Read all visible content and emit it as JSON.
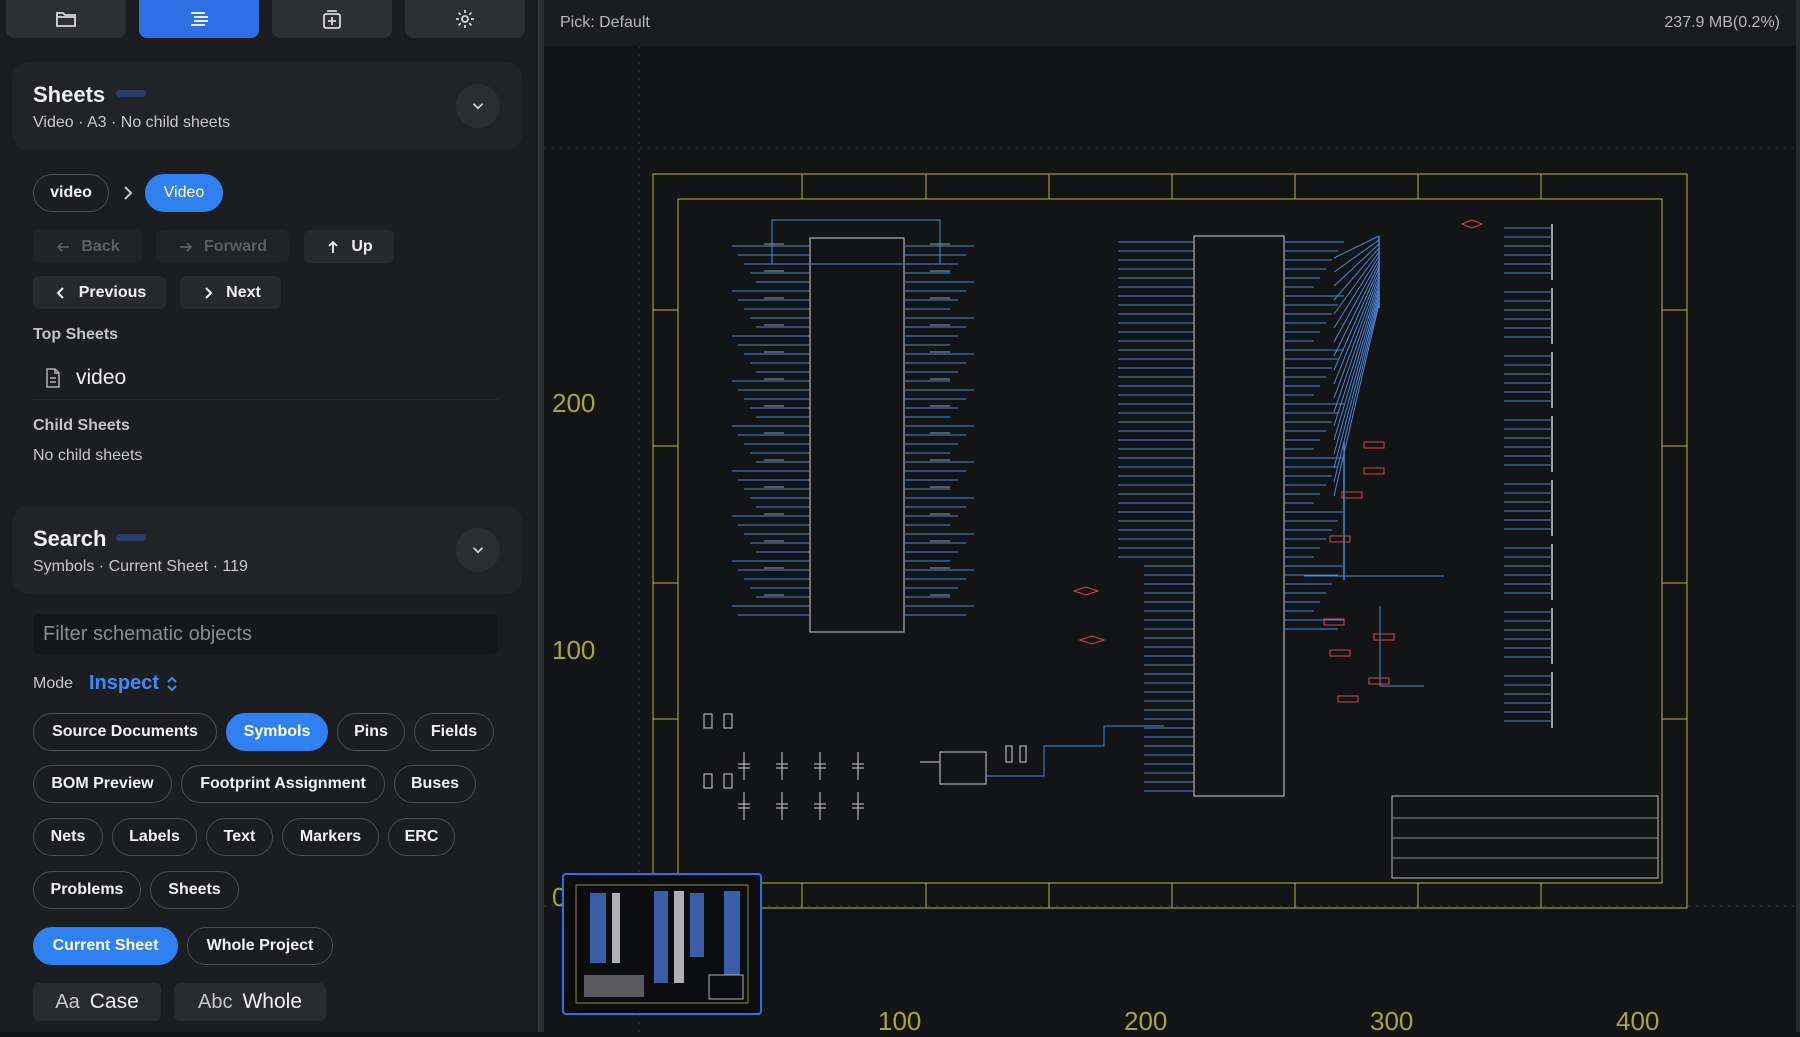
{
  "toolbar": {
    "tabs": [
      {
        "icon": "folder-icon"
      },
      {
        "icon": "list-icon",
        "active": true
      },
      {
        "icon": "add-sheet-icon"
      },
      {
        "icon": "gear-icon"
      }
    ]
  },
  "sheets": {
    "title": "Sheets",
    "subtitle": "Video · A3 · No child sheets",
    "breadcrumb": [
      "video",
      "Video"
    ],
    "back_label": "Back",
    "forward_label": "Forward",
    "up_label": "Up",
    "previous_label": "Previous",
    "next_label": "Next",
    "top_sheets_label": "Top Sheets",
    "top_sheet_item": "video",
    "child_sheets_label": "Child Sheets",
    "child_sheets_empty": "No child sheets"
  },
  "search": {
    "title": "Search",
    "subtitle": "Symbols · Current Sheet · 119",
    "placeholder": "Filter schematic objects",
    "mode_label": "Mode",
    "mode_value": "Inspect",
    "categories": [
      {
        "label": "Source Documents",
        "selected": false
      },
      {
        "label": "Symbols",
        "selected": true
      },
      {
        "label": "Pins",
        "selected": false
      },
      {
        "label": "Fields",
        "selected": false
      },
      {
        "label": "BOM Preview",
        "selected": false
      },
      {
        "label": "Footprint Assignment",
        "selected": false
      },
      {
        "label": "Buses",
        "selected": false
      },
      {
        "label": "Nets",
        "selected": false
      },
      {
        "label": "Labels",
        "selected": false
      },
      {
        "label": "Text",
        "selected": false
      },
      {
        "label": "Markers",
        "selected": false
      },
      {
        "label": "ERC",
        "selected": false
      },
      {
        "label": "Problems",
        "selected": false
      },
      {
        "label": "Sheets",
        "selected": false
      }
    ],
    "scope": [
      {
        "label": "Current Sheet",
        "selected": true
      },
      {
        "label": "Whole Project",
        "selected": false
      }
    ],
    "case_prefix": "Aa",
    "case_label": "Case",
    "whole_prefix": "Abc",
    "whole_label": "Whole"
  },
  "canvas": {
    "pick_label": "Pick: Default",
    "memory": "237.9 MB(0.2%)",
    "y_axis_labels": [
      "200",
      "100",
      "0"
    ],
    "x_axis_labels": [
      "100",
      "200",
      "300",
      "400"
    ],
    "colors": {
      "frame": "#b8b43a",
      "wire": "#4a86d8",
      "component": "#d0d0d0",
      "marker": "#d04a4a",
      "axis_label": "#a8a634",
      "accent": "#2f80f0"
    }
  }
}
